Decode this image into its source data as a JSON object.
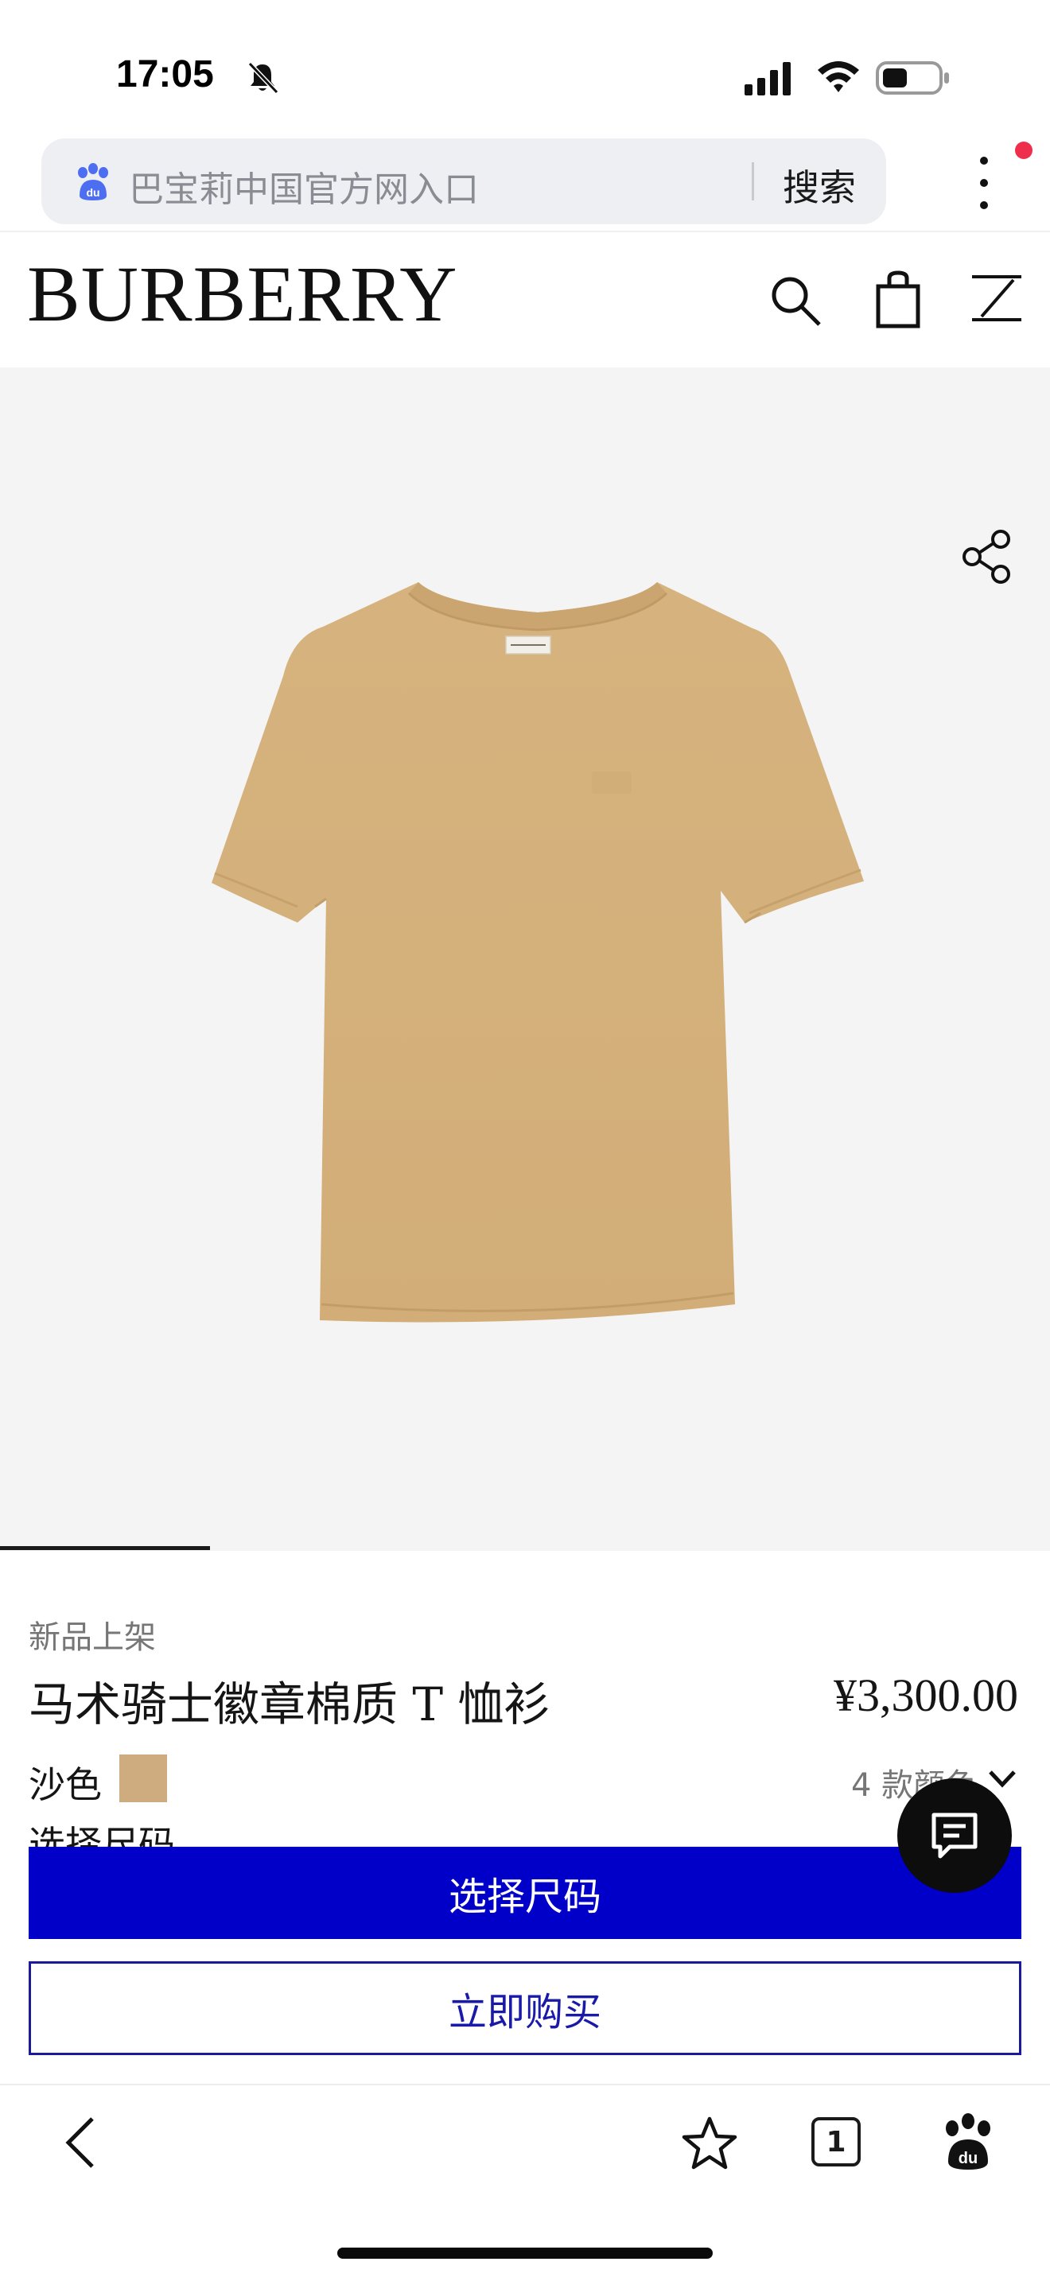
{
  "status_bar": {
    "time": "17:05",
    "icons": [
      "bell-slash-icon",
      "signal-icon",
      "wifi-icon",
      "battery-icon"
    ]
  },
  "browser": {
    "search_query": "巴宝莉中国官方网入口",
    "search_button": "搜索",
    "icons": [
      "baidu-paw-icon",
      "more-vertical-icon"
    ],
    "notification_dot_color": "#ee2e4c"
  },
  "site_header": {
    "brand": "BURBERRY",
    "icons": [
      "search-icon",
      "shopping-bag-icon",
      "menu-icon"
    ]
  },
  "product": {
    "tag": "新品上架",
    "name": "马术骑士徽章棉质 T 恤衫",
    "price": "¥3,300.00",
    "color_name": "沙色",
    "color_swatch": "#cfac7f",
    "color_count": "4 款颜色",
    "size_label": "选择尺码",
    "image_background": "#f4f4f4",
    "image_position": 1
  },
  "actions": {
    "select_size": "选择尺码",
    "buy_now": "立即购买",
    "primary_color": "#0000c8"
  },
  "bottom_toolbar": {
    "tab_count": "1",
    "icons": [
      "back-icon",
      "star-icon",
      "tabs-icon",
      "baidu-paw-icon"
    ]
  }
}
